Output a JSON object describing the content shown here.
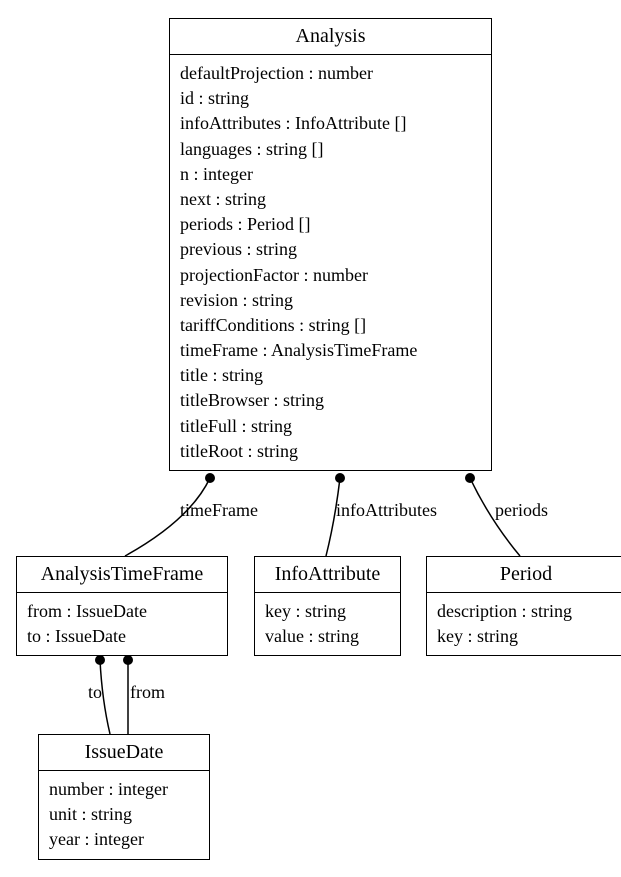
{
  "analysis": {
    "title": "Analysis",
    "attrs": [
      "defaultProjection : number",
      "id : string",
      "infoAttributes : InfoAttribute []",
      "languages : string []",
      "n : integer",
      "next : string",
      "periods : Period []",
      "previous : string",
      "projectionFactor : number",
      "revision : string",
      "tariffConditions : string []",
      "timeFrame : AnalysisTimeFrame",
      "title : string",
      "titleBrowser : string",
      "titleFull : string",
      "titleRoot : string"
    ]
  },
  "analysisTimeFrame": {
    "title": "AnalysisTimeFrame",
    "attrs": [
      "from : IssueDate",
      "to : IssueDate"
    ]
  },
  "infoAttribute": {
    "title": "InfoAttribute",
    "attrs": [
      "key : string",
      "value : string"
    ]
  },
  "period": {
    "title": "Period",
    "attrs": [
      "description : string",
      "key : string"
    ]
  },
  "issueDate": {
    "title": "IssueDate",
    "attrs": [
      "number : integer",
      "unit : string",
      "year : integer"
    ]
  },
  "edges": {
    "timeFrame": "timeFrame",
    "infoAttributes": "infoAttributes",
    "periods": "periods",
    "to": "to",
    "from": "from"
  }
}
